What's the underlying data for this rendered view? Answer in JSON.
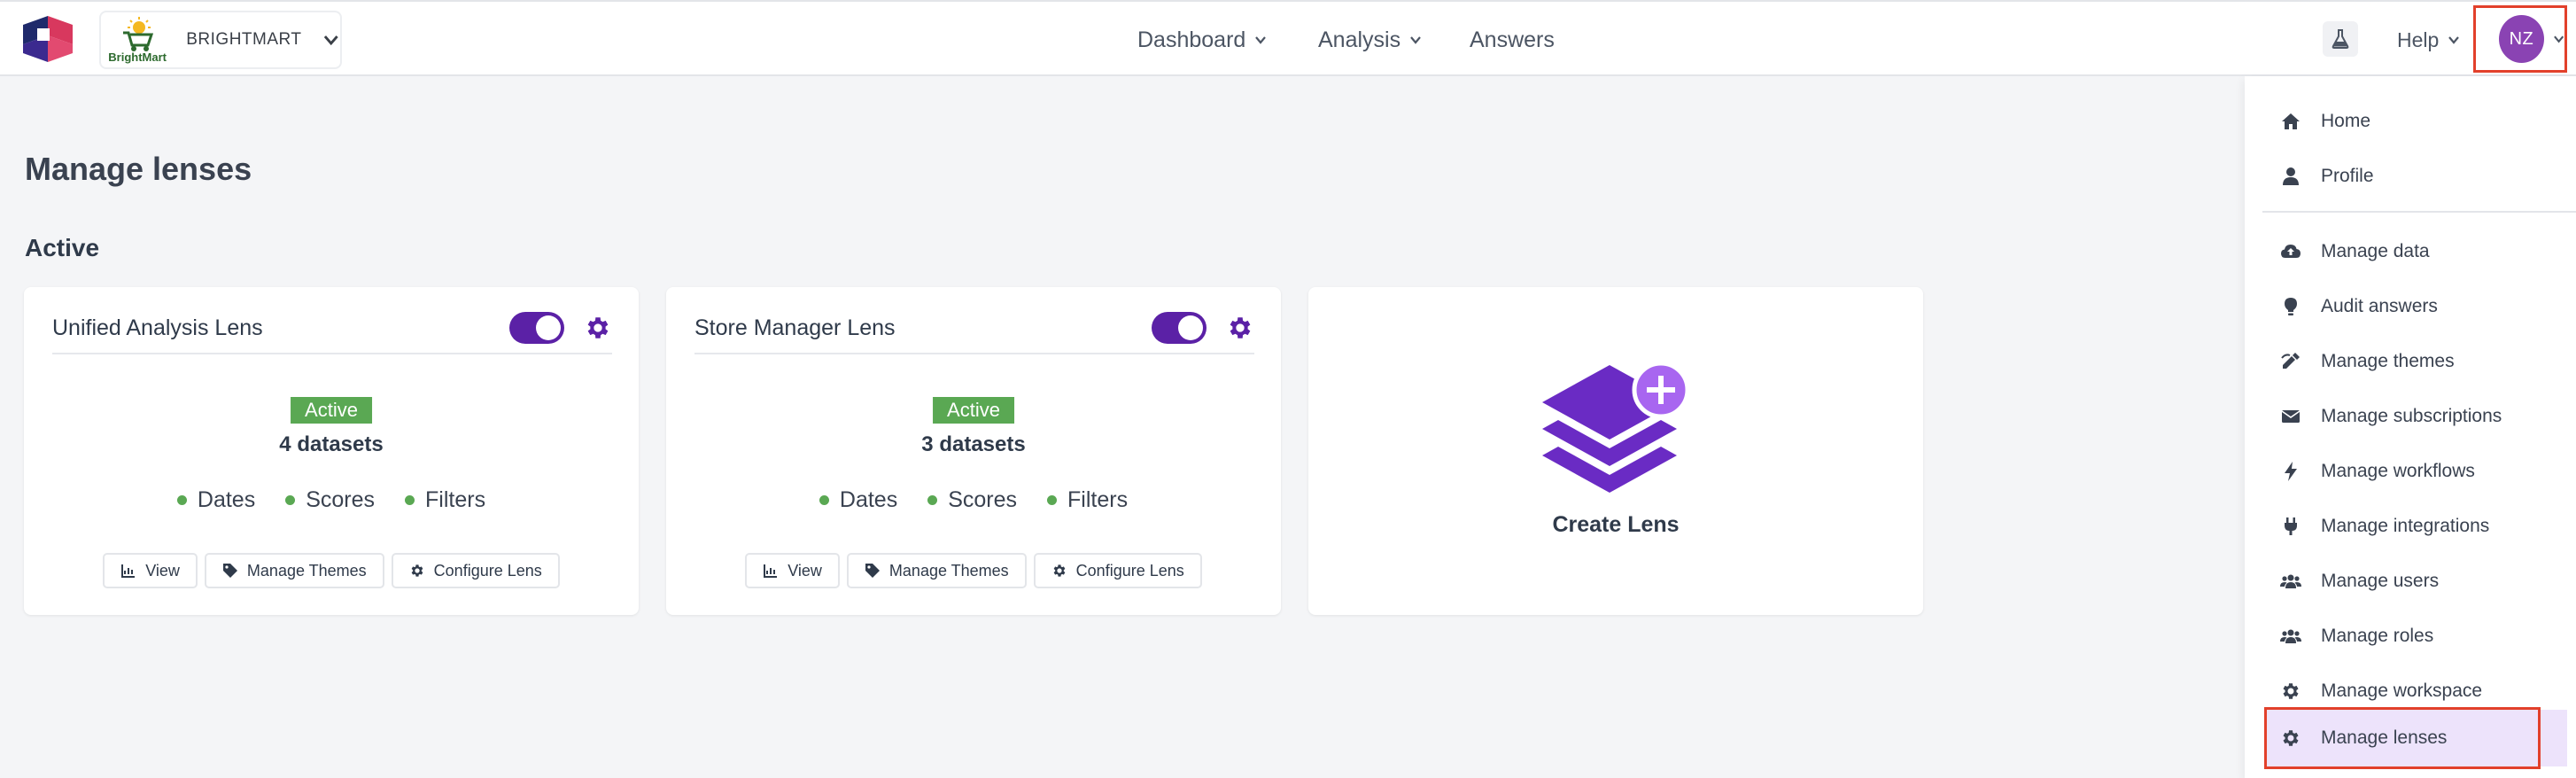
{
  "header": {
    "tenant_logo_text": "BrightMart",
    "tenant_name": "BRIGHTMART",
    "nav": [
      {
        "label": "Dashboard",
        "has_dropdown": true
      },
      {
        "label": "Analysis",
        "has_dropdown": true
      },
      {
        "label": "Answers",
        "has_dropdown": false
      }
    ],
    "help_label": "Help",
    "user_initials": "NZ",
    "icons": {
      "flask": "flask-icon",
      "chevron": "chevron-down-icon"
    }
  },
  "page": {
    "title": "Manage lenses",
    "section": "Active"
  },
  "lenses": [
    {
      "name": "Unified Analysis Lens",
      "enabled": true,
      "status": "Active",
      "datasets": "4 datasets",
      "tags": [
        "Dates",
        "Scores",
        "Filters"
      ],
      "actions": [
        "View",
        "Manage Themes",
        "Configure Lens"
      ]
    },
    {
      "name": "Store Manager Lens",
      "enabled": true,
      "status": "Active",
      "datasets": "3 datasets",
      "tags": [
        "Dates",
        "Scores",
        "Filters"
      ],
      "actions": [
        "View",
        "Manage Themes",
        "Configure Lens"
      ]
    }
  ],
  "create_lens": {
    "label": "Create Lens"
  },
  "menu": {
    "items": [
      {
        "label": "Home",
        "icon": "home-icon"
      },
      {
        "label": "Profile",
        "icon": "user-icon"
      },
      {
        "label": "Manage data",
        "icon": "cloud-upload-icon"
      },
      {
        "label": "Audit answers",
        "icon": "lightbulb-icon"
      },
      {
        "label": "Manage themes",
        "icon": "palette-icon"
      },
      {
        "label": "Manage subscriptions",
        "icon": "envelope-icon"
      },
      {
        "label": "Manage workflows",
        "icon": "bolt-icon"
      },
      {
        "label": "Manage integrations",
        "icon": "plug-icon"
      },
      {
        "label": "Manage users",
        "icon": "users-icon"
      },
      {
        "label": "Manage roles",
        "icon": "user-group-icon"
      },
      {
        "label": "Manage workspace",
        "icon": "gear-icon"
      },
      {
        "label": "Manage lenses",
        "icon": "gear-icon",
        "active": true
      }
    ]
  },
  "colors": {
    "accent": "#5b21a6",
    "avatar": "#8a43b3",
    "success": "#5aa853",
    "highlight_frame": "#e2402b",
    "menu_active_bg": "#ede3fb"
  }
}
